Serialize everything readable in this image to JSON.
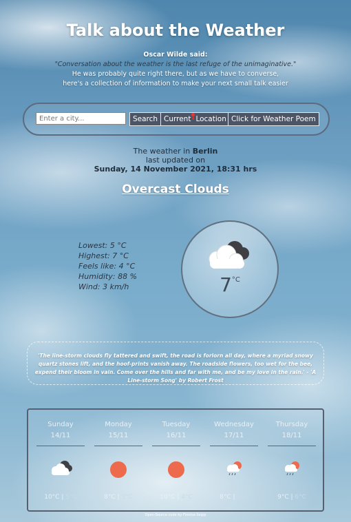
{
  "header": {
    "title": "Talk about the Weather",
    "attribution": "Oscar Wilde said:",
    "quote": "\"Conversation about the weather is the last refuge of the unimaginative.\"",
    "line1": "He was probably quite right there, but as we have to converse,",
    "line2": "here's a collection of information to make your next small talk easier"
  },
  "search": {
    "placeholder": "Enter a city...",
    "search_label": "Search",
    "current_label": "Current",
    "location_label": "Location",
    "poem_label": "Click for Weather Poem"
  },
  "weather": {
    "prefix": "The weather in",
    "city": "Berlin",
    "updated_label": "last updated on",
    "updated": "Sunday, 14 November 2021, 18:31 hrs",
    "condition": "Overcast Clouds",
    "temperature": "7",
    "unit": "°C",
    "lowest": "Lowest: 5 °C",
    "highest": "Highest: 7 °C",
    "feels_like": "Feels like: 4 °C",
    "humidity": "Humidity: 88 %",
    "wind": "Wind: 3 km/h",
    "icon": "cloudy-dark-icon"
  },
  "poem": {
    "text": "'The line-storm clouds fly tattered and swift, the road is forlorn all day, where a myriad snowy quartz stones lift, and the hoof-prints vanish away. The roadside flowers, too wet for the bee, expend their bloom in vain. Come over the hills and far with me, and be my love in the rain.' - 'A Line-storm Song' by Robert Frost"
  },
  "forecast": [
    {
      "day": "Sunday",
      "date": "14/11",
      "icon": "cloudy-icon",
      "high": "10°C",
      "low": "5°C"
    },
    {
      "day": "Monday",
      "date": "15/11",
      "icon": "sun-icon",
      "high": "8°C",
      "low": "3°C"
    },
    {
      "day": "Tuesday",
      "date": "16/11",
      "icon": "sun-icon",
      "high": "10°C",
      "low": "4°C"
    },
    {
      "day": "Wednesday",
      "date": "17/11",
      "icon": "rain-sun-icon",
      "high": "8°C",
      "low": "3°C"
    },
    {
      "day": "Thursday",
      "date": "18/11",
      "icon": "rain-sun-icon",
      "high": "9°C",
      "low": "6°C"
    }
  ],
  "footer": {
    "link": "Open-Source code",
    "by": "by Finnine Seipp"
  },
  "colors": {
    "sun": "#ee6a4d",
    "button_bg": "#4c5566"
  }
}
